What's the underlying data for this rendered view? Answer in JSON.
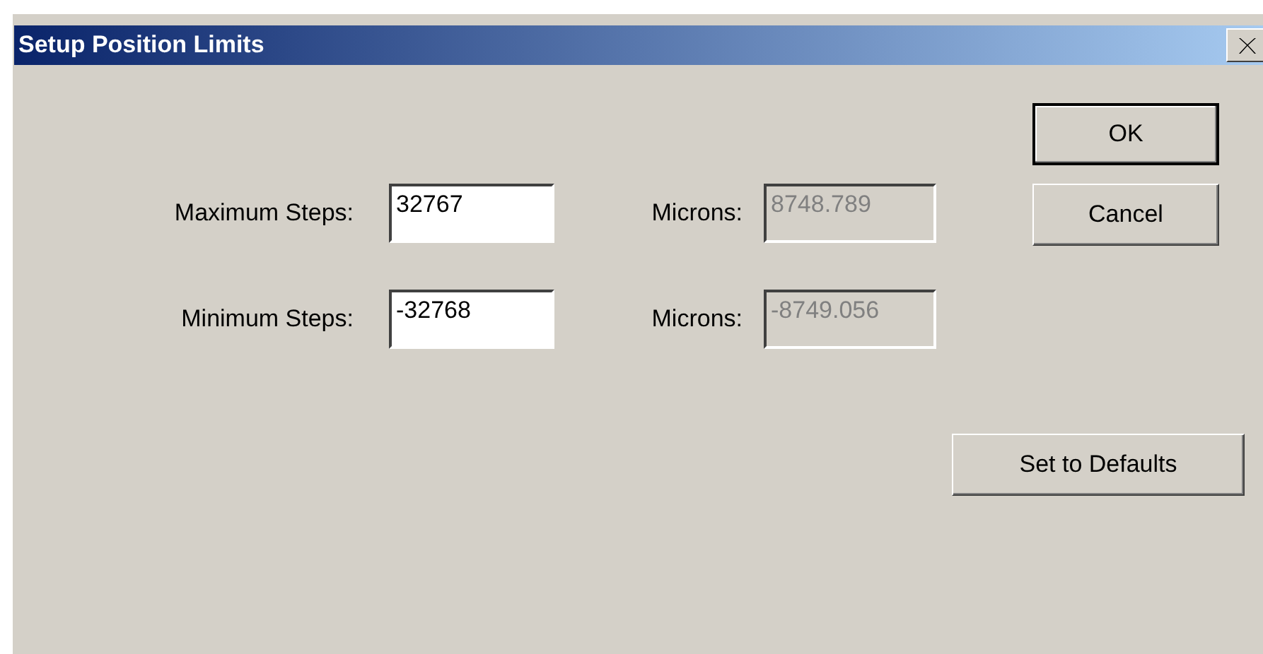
{
  "window": {
    "title": "Setup Position Limits"
  },
  "rows": [
    {
      "label": "Maximum Steps:",
      "value": "32767",
      "microns_label": "Microns:",
      "microns_value": "8748.789",
      "microns_disabled": true
    },
    {
      "label": "Minimum Steps:",
      "value": "-32768",
      "microns_label": "Microns:",
      "microns_value": "-8749.056",
      "microns_disabled": true
    }
  ],
  "buttons": [
    {
      "label": "OK",
      "kind": "default"
    },
    {
      "label": "Cancel",
      "kind": "normal"
    },
    {
      "label": "Set to Defaults",
      "kind": "separate"
    }
  ]
}
